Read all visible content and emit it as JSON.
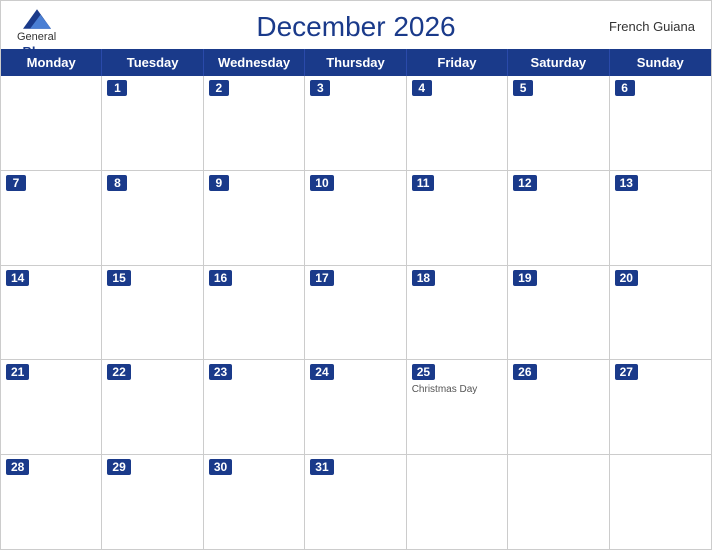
{
  "header": {
    "title": "December 2026",
    "country": "French Guiana",
    "logo": {
      "line1": "General",
      "line2": "Blue"
    }
  },
  "dayHeaders": [
    "Monday",
    "Tuesday",
    "Wednesday",
    "Thursday",
    "Friday",
    "Saturday",
    "Sunday"
  ],
  "weeks": [
    [
      {
        "day": "",
        "empty": true
      },
      {
        "day": "1"
      },
      {
        "day": "2"
      },
      {
        "day": "3"
      },
      {
        "day": "4"
      },
      {
        "day": "5"
      },
      {
        "day": "6"
      }
    ],
    [
      {
        "day": "7"
      },
      {
        "day": "8"
      },
      {
        "day": "9"
      },
      {
        "day": "10"
      },
      {
        "day": "11"
      },
      {
        "day": "12"
      },
      {
        "day": "13"
      }
    ],
    [
      {
        "day": "14"
      },
      {
        "day": "15"
      },
      {
        "day": "16"
      },
      {
        "day": "17"
      },
      {
        "day": "18"
      },
      {
        "day": "19"
      },
      {
        "day": "20"
      }
    ],
    [
      {
        "day": "21"
      },
      {
        "day": "22"
      },
      {
        "day": "23"
      },
      {
        "day": "24"
      },
      {
        "day": "25",
        "event": "Christmas Day"
      },
      {
        "day": "26"
      },
      {
        "day": "27"
      }
    ],
    [
      {
        "day": "28"
      },
      {
        "day": "29"
      },
      {
        "day": "30"
      },
      {
        "day": "31"
      },
      {
        "day": "",
        "empty": true
      },
      {
        "day": "",
        "empty": true
      },
      {
        "day": "",
        "empty": true
      }
    ]
  ]
}
